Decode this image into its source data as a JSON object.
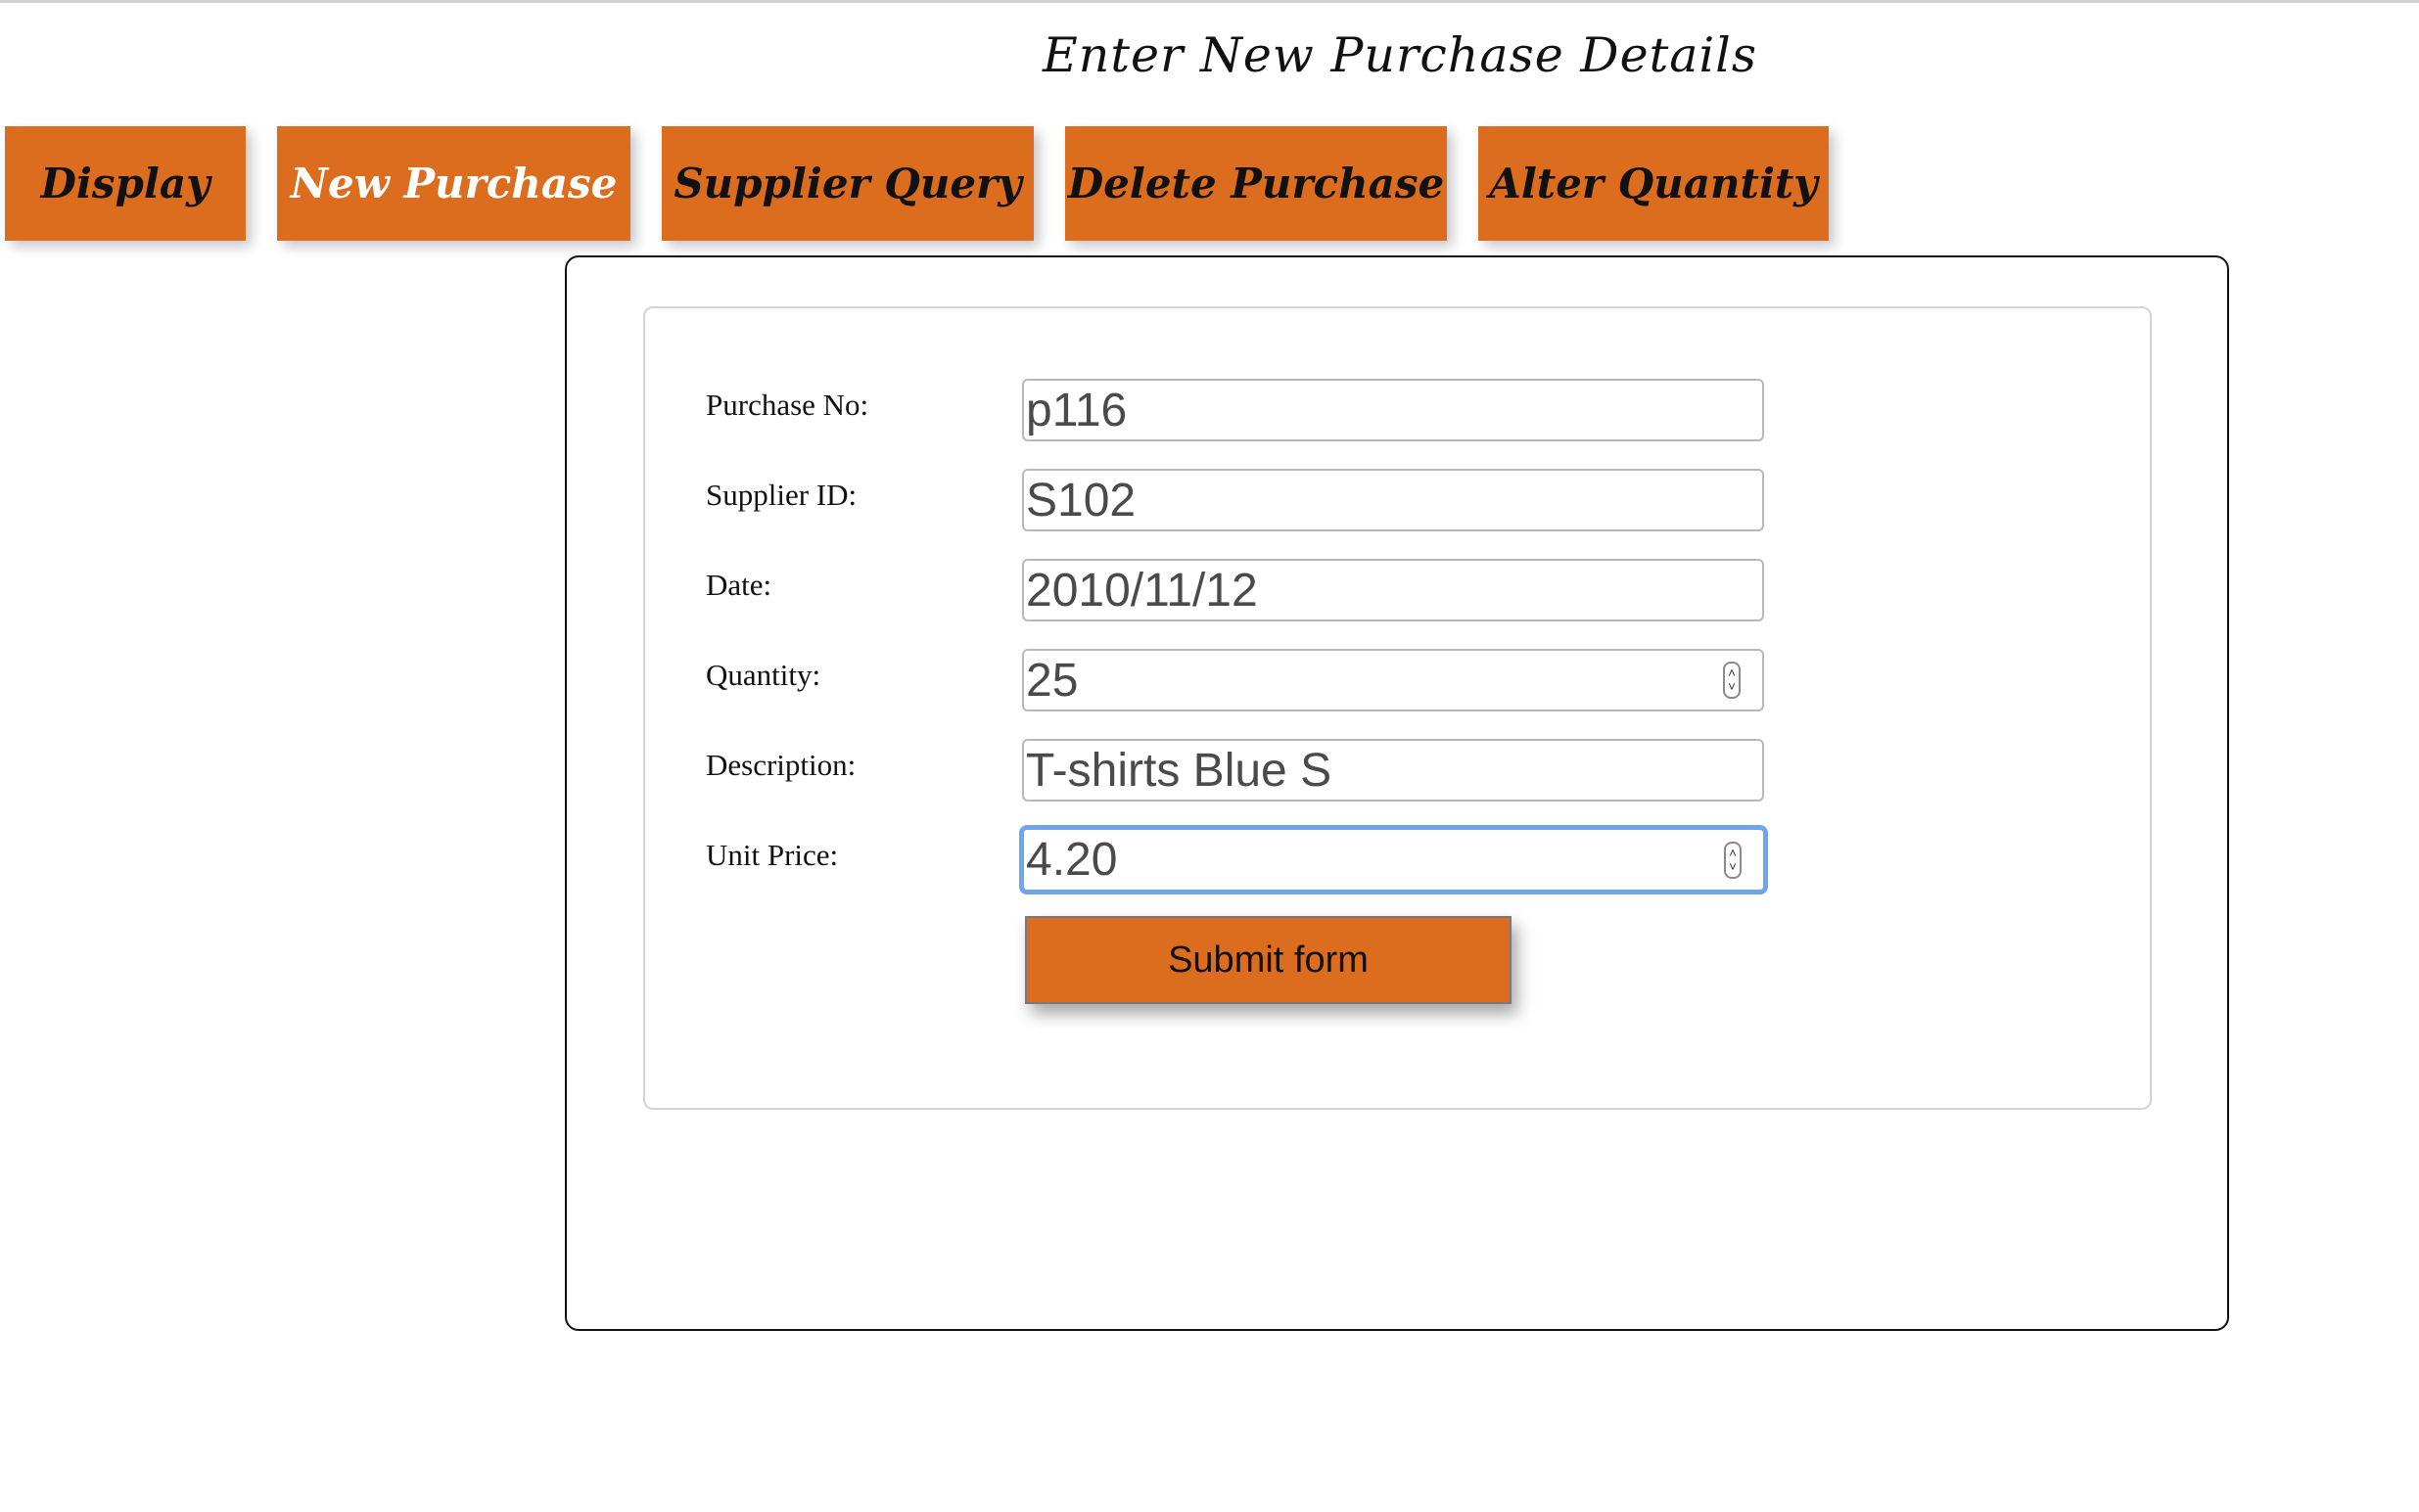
{
  "page": {
    "title": "Enter New Purchase Details"
  },
  "nav": {
    "items": [
      {
        "label": "Display",
        "active": false
      },
      {
        "label": "New Purchase",
        "active": true
      },
      {
        "label": "Supplier Query",
        "active": false
      },
      {
        "label": "Delete Purchase",
        "active": false
      },
      {
        "label": "Alter Quantity",
        "active": false
      }
    ]
  },
  "form": {
    "fields": [
      {
        "label": "Purchase No:",
        "value": "p116"
      },
      {
        "label": "Supplier ID:",
        "value": "S102"
      },
      {
        "label": "Date:",
        "value": "2010/11/12"
      },
      {
        "label": "Quantity:",
        "value": "25"
      },
      {
        "label": "Description:",
        "value": "T-shirts Blue S"
      },
      {
        "label": "Unit Price:",
        "value": "4.20"
      }
    ],
    "submit_label": "Submit form"
  },
  "colors": {
    "accent": "#dc6c1e",
    "focus_ring": "#6ea6ec",
    "active_nav_text": "#ffffff"
  },
  "icons": {
    "spinner": "up-down-spinner-icon"
  }
}
